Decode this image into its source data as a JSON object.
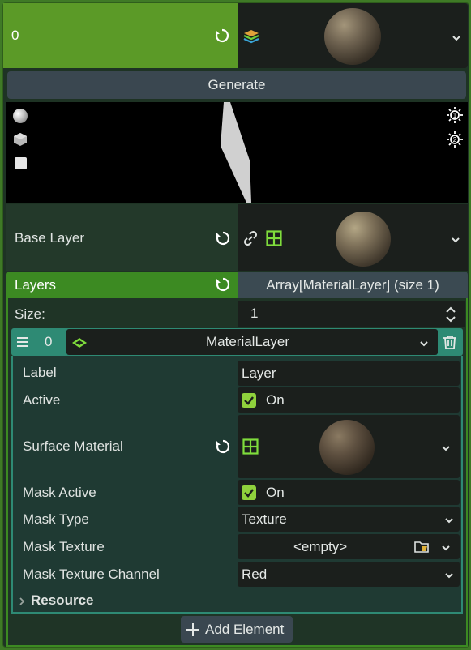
{
  "header": {
    "value": "0"
  },
  "generate_label": "Generate",
  "base_layer": {
    "label": "Base Layer"
  },
  "layers": {
    "label": "Layers",
    "type_label": "Array[MaterialLayer] (size 1)",
    "size_label": "Size:",
    "size_value": "1"
  },
  "element": {
    "index": "0",
    "type": "MaterialLayer",
    "properties": {
      "label_key": "Label",
      "label_value": "Layer",
      "active_key": "Active",
      "active_value": "On",
      "surface_material_key": "Surface Material",
      "mask_active_key": "Mask Active",
      "mask_active_value": "On",
      "mask_type_key": "Mask Type",
      "mask_type_value": "Texture",
      "mask_texture_key": "Mask Texture",
      "mask_texture_value": "<empty>",
      "mask_channel_key": "Mask Texture Channel",
      "mask_channel_value": "Red",
      "resource_label": "Resource"
    }
  },
  "add_element_label": "Add Element",
  "colors": {
    "accent_green": "#3c8a22",
    "header_green": "#5b9a27",
    "element_teal": "#2e8a74",
    "check_green": "#8fd13c"
  },
  "icons": [
    "revert-icon",
    "layer-stack-icon",
    "chevron-down-icon",
    "link-icon",
    "grid-icon",
    "up-down-icon",
    "menu-icon",
    "diamond-icon",
    "trash-icon",
    "checkbox-icon",
    "folder-icon",
    "chevron-right-icon",
    "plus-icon",
    "sun-1-icon",
    "sun-2-icon",
    "sphere-shape-icon",
    "cube-shape-icon",
    "plane-shape-icon"
  ]
}
